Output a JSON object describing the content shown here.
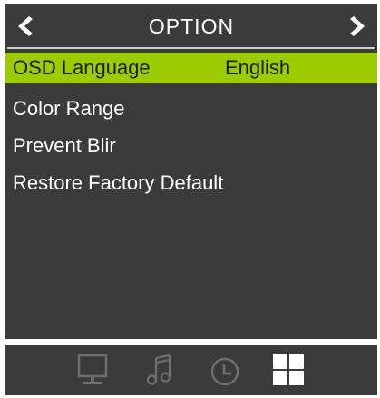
{
  "header": {
    "title": "OPTION",
    "left_arrow_icon": "chevron-left-icon",
    "right_arrow_icon": "chevron-right-icon"
  },
  "menu": {
    "items": [
      {
        "label": "OSD Language",
        "value": "English",
        "selected": true
      },
      {
        "label": "Color Range"
      },
      {
        "label": "Prevent Blir"
      },
      {
        "label": "Restore Factory Default"
      }
    ]
  },
  "bottom_bar": {
    "icons": [
      "monitor-icon",
      "music-icon",
      "clock-icon",
      "option-grid-icon"
    ],
    "active": "option-grid-icon"
  },
  "colors": {
    "panel": "#3b3b3b",
    "highlight": "#9ccc00",
    "inactive_icon": "#6e6e6e",
    "active_icon": "#ffffff"
  }
}
